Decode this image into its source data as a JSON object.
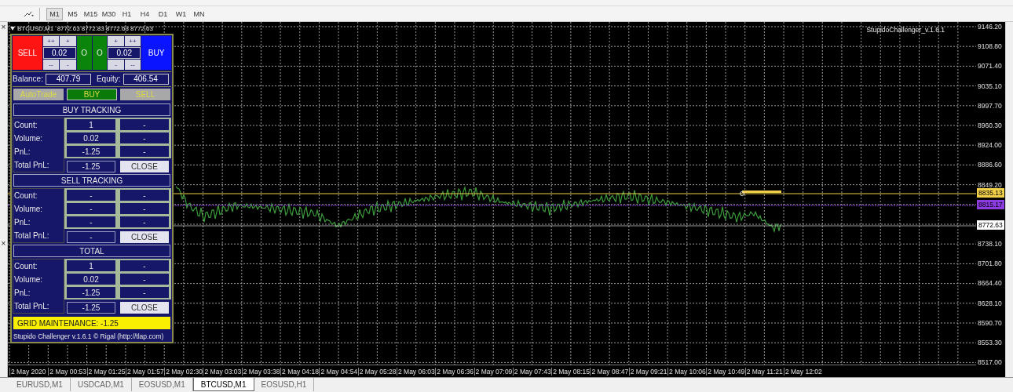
{
  "toolbar": {
    "timeframes": [
      {
        "label": "M1",
        "selected": true
      },
      {
        "label": "M5",
        "selected": false
      },
      {
        "label": "M15",
        "selected": false
      },
      {
        "label": "M30",
        "selected": false
      },
      {
        "label": "H1",
        "selected": false
      },
      {
        "label": "H4",
        "selected": false
      },
      {
        "label": "D1",
        "selected": false
      },
      {
        "label": "W1",
        "selected": false
      },
      {
        "label": "MN",
        "selected": false
      }
    ]
  },
  "left_strip": {
    "close_marks": [
      "×",
      "×"
    ]
  },
  "chart": {
    "header": "BTCUSD,M1  8772.63 8772.83 8772.63 8772.63",
    "indicator_label": "StupidoChallenger_v.1.6.1",
    "price_ticks_upper": [
      "9146.20",
      "9108.80",
      "9071.40",
      "9035.10",
      "8997.70",
      "8960.30",
      "8924.00",
      "8886.60",
      "8849.20"
    ],
    "price_ticks_lower": [
      "8738.10",
      "8701.80",
      "8664.40",
      "8628.10",
      "8590.70",
      "8553.30",
      "8517.00"
    ],
    "price_markers": [
      {
        "label": "8835.13",
        "color": "#f0d048"
      },
      {
        "label": "8815.17",
        "color": "#8c3ce0"
      },
      {
        "label": "8772.63",
        "color": "#ffffff"
      }
    ],
    "time_labels": [
      "2 May 2020",
      "2 May 00:53",
      "2 May 01:25",
      "2 May 01:57",
      "2 May 02:30",
      "2 May 03:03",
      "2 May 03:38",
      "2 May 04:18",
      "2 May 04:54",
      "2 May 05:28",
      "2 May 06:03",
      "2 May 06:36",
      "2 May 07:09",
      "2 May 07:43",
      "2 May 08:15",
      "2 May 08:47",
      "2 May 09:21",
      "2 May 10:06",
      "2 May 10:49",
      "2 May 11:21",
      "2 May 12:02"
    ]
  },
  "panel": {
    "trade": {
      "sell": "SELL",
      "buy": "BUY",
      "left_lot": {
        "inc": [
          "++",
          "+"
        ],
        "value": "0.02",
        "dec": [
          "--",
          "-"
        ]
      },
      "center": [
        "O",
        "O"
      ],
      "right_lot": {
        "inc": [
          "+",
          "++"
        ],
        "value": "0.02",
        "dec": [
          "-",
          "--"
        ]
      }
    },
    "account": {
      "balance_label": "Balance:",
      "balance": "407.79",
      "equity_label": "Equity:",
      "equity": "406.54"
    },
    "modes": [
      {
        "label": "AutoTrade",
        "on": false
      },
      {
        "label": "BUY",
        "on": true
      },
      {
        "label": "SELL",
        "on": false
      }
    ],
    "sections": [
      {
        "title": "BUY TRACKING",
        "rows": [
          {
            "label": "Count:",
            "values": [
              "1",
              "-"
            ]
          },
          {
            "label": "Volume:",
            "values": [
              "0.02",
              "-"
            ]
          },
          {
            "label": "PnL:",
            "values": [
              "-1.25",
              "-"
            ]
          }
        ],
        "total": {
          "label": "Total PnL:",
          "value": "-1.25",
          "button": "CLOSE"
        }
      },
      {
        "title": "SELL TRACKING",
        "rows": [
          {
            "label": "Count:",
            "values": [
              "-",
              "-"
            ]
          },
          {
            "label": "Volume:",
            "values": [
              "-",
              "-"
            ]
          },
          {
            "label": "PnL:",
            "values": [
              "-",
              "-"
            ]
          }
        ],
        "total": {
          "label": "Total PnL:",
          "value": "-",
          "button": "CLOSE"
        }
      },
      {
        "title": "TOTAL",
        "rows": [
          {
            "label": "Count:",
            "values": [
              "1",
              "-"
            ]
          },
          {
            "label": "Volume:",
            "values": [
              "0.02",
              "-"
            ]
          },
          {
            "label": "PnL:",
            "values": [
              "-1.25",
              "-"
            ]
          }
        ],
        "total": {
          "label": "Total PnL:",
          "value": "-1.25",
          "button": "CLOSE"
        }
      }
    ],
    "grid_maintenance": "GRID MAINTENANCE: -1.25",
    "footer": "Stupido Challenger v.1.6.1 © Rigal (http://tlap.com)"
  },
  "tabs": [
    {
      "label": "EURUSD,M1",
      "selected": false
    },
    {
      "label": "USDCAD,M1",
      "selected": false
    },
    {
      "label": "EOSUSD,M1",
      "selected": false
    },
    {
      "label": "BTCUSD,M1",
      "selected": true
    },
    {
      "label": "EOSUSD,H1",
      "selected": false
    }
  ]
}
